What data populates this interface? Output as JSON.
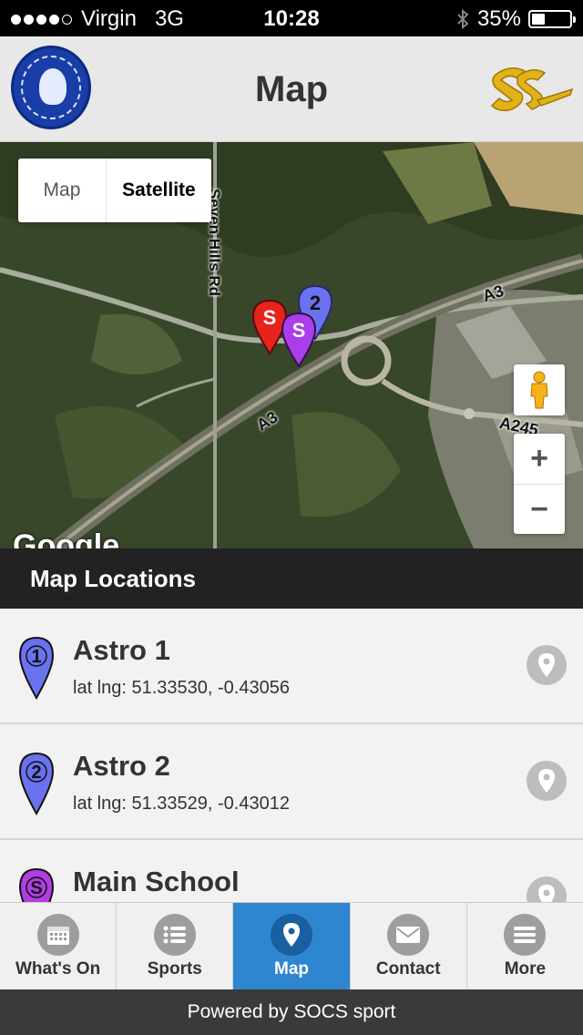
{
  "status_bar": {
    "carrier": "Virgin",
    "network": "3G",
    "time": "10:28",
    "battery": "35%"
  },
  "header": {
    "title": "Map"
  },
  "map": {
    "type_toggle": {
      "map_label": "Map",
      "satellite_label": "Satellite",
      "selected": "Satellite"
    },
    "zoom_in_label": "+",
    "zoom_out_label": "−",
    "road_labels": {
      "seven_hills": "Seven Hills Rd",
      "a3_north": "A3",
      "a3_south": "A3",
      "a245": "A245"
    },
    "watermark": "Google",
    "pins": [
      {
        "label": "S",
        "color": "#e8231e"
      },
      {
        "label": "S",
        "color": "#a93fe8"
      },
      {
        "label": "2",
        "color": "#6b72f0"
      }
    ]
  },
  "section": {
    "title": "Map Locations"
  },
  "locations": [
    {
      "name": "Astro 1",
      "coords": "lat lng: 51.33530, -0.43056",
      "marker_label": "1",
      "marker_color": "#6b72f0"
    },
    {
      "name": "Astro 2",
      "coords": "lat lng: 51.33529, -0.43012",
      "marker_label": "2",
      "marker_color": "#6b72f0"
    },
    {
      "name": "Main School",
      "coords": "",
      "marker_label": "S",
      "marker_color": "#b03ee0"
    }
  ],
  "tabs": [
    {
      "label": "What's On",
      "icon": "calendar-icon",
      "active": false
    },
    {
      "label": "Sports",
      "icon": "list-icon",
      "active": false
    },
    {
      "label": "Map",
      "icon": "map-pin-icon",
      "active": true
    },
    {
      "label": "Contact",
      "icon": "envelope-icon",
      "active": false
    },
    {
      "label": "More",
      "icon": "menu-icon",
      "active": false
    }
  ],
  "footer": {
    "text": "Powered by SOCS sport"
  },
  "colors": {
    "accent": "#2f86d0",
    "header_bg": "#e8e8e8",
    "section_bg": "#222222"
  }
}
